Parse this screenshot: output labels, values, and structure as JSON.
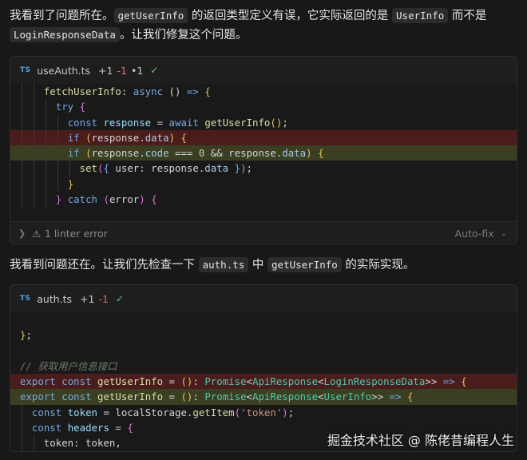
{
  "para1": {
    "t1": "我看到了问题所在。",
    "c1": "getUserInfo",
    "t2": " 的返回类型定义有误，它实际返回的是 ",
    "c2": "UserInfo",
    "t3": " 而不是",
    "c3": "LoginResponseData",
    "t4": "。让我们修复这个问题。"
  },
  "card1": {
    "lang": "TS",
    "filename": "useAuth.ts",
    "stat_add": "+1",
    "stat_del": "-1",
    "stat_mod": "•1",
    "footer_label": "1 linter error",
    "footer_action": "Auto-fix"
  },
  "para2": {
    "t1": "我看到问题还在。让我们先检查一下 ",
    "c1": "auth.ts",
    "t2": " 中 ",
    "c2": "getUserInfo",
    "t3": " 的实际实现。"
  },
  "card2": {
    "lang": "TS",
    "filename": "auth.ts",
    "stat_add": "+1",
    "stat_del": "-1"
  },
  "code1": [
    {
      "type": "normal",
      "indent": 2,
      "tokens": [
        [
          "fn",
          "fetchUserInfo"
        ],
        [
          "txt",
          ": "
        ],
        [
          "kw",
          "async"
        ],
        [
          "txt",
          " () "
        ],
        [
          "kw",
          "=>"
        ],
        [
          "txt",
          " "
        ],
        [
          "br1",
          "{"
        ]
      ]
    },
    {
      "type": "normal",
      "indent": 3,
      "tokens": [
        [
          "kw",
          "try"
        ],
        [
          "txt",
          " "
        ],
        [
          "br2",
          "{"
        ]
      ]
    },
    {
      "type": "normal",
      "indent": 4,
      "tokens": [
        [
          "kw",
          "const"
        ],
        [
          "txt",
          " "
        ],
        [
          "var",
          "response"
        ],
        [
          "txt",
          " = "
        ],
        [
          "kw",
          "await"
        ],
        [
          "txt",
          " "
        ],
        [
          "fn",
          "getUserInfo"
        ],
        [
          "br1",
          "()"
        ],
        [
          "txt",
          ";"
        ]
      ]
    },
    {
      "type": "del",
      "indent": 4,
      "tokens": [
        [
          "kw",
          "if"
        ],
        [
          "txt",
          " "
        ],
        [
          "br1",
          "("
        ],
        [
          "txt",
          "response."
        ],
        [
          "prop",
          "data"
        ],
        [
          "br1",
          ")"
        ],
        [
          "txt",
          " "
        ],
        [
          "br1",
          "{"
        ]
      ]
    },
    {
      "type": "add",
      "indent": 4,
      "tokens": [
        [
          "kw",
          "if"
        ],
        [
          "txt",
          " "
        ],
        [
          "br1",
          "("
        ],
        [
          "txt",
          "response."
        ],
        [
          "prop",
          "code"
        ],
        [
          "txt",
          " === "
        ],
        [
          "num",
          "0"
        ],
        [
          "txt",
          " && response."
        ],
        [
          "prop",
          "data"
        ],
        [
          "br1",
          ")"
        ],
        [
          "txt",
          " "
        ],
        [
          "br1",
          "{"
        ]
      ]
    },
    {
      "type": "normal",
      "indent": 5,
      "tokens": [
        [
          "fn",
          "set"
        ],
        [
          "br2",
          "("
        ],
        [
          "br3",
          "{"
        ],
        [
          "txt",
          " user: response."
        ],
        [
          "prop",
          "data"
        ],
        [
          "txt",
          " "
        ],
        [
          "br3",
          "}"
        ],
        [
          "br2",
          ")"
        ],
        [
          "txt",
          ";"
        ]
      ]
    },
    {
      "type": "normal",
      "indent": 4,
      "tokens": [
        [
          "br1",
          "}"
        ]
      ]
    },
    {
      "type": "normal",
      "indent": 3,
      "tokens": [
        [
          "br2",
          "}"
        ],
        [
          "txt",
          " "
        ],
        [
          "kw",
          "catch"
        ],
        [
          "txt",
          " "
        ],
        [
          "br2",
          "("
        ],
        [
          "txt",
          "error"
        ],
        [
          "br2",
          ")"
        ],
        [
          "txt",
          " "
        ],
        [
          "br2",
          "{"
        ]
      ]
    }
  ],
  "code2": [
    {
      "type": "normal",
      "indent": 0,
      "tokens": [
        [
          "txt",
          ""
        ]
      ]
    },
    {
      "type": "normal",
      "indent": 0,
      "tokens": [
        [
          "br1",
          "}"
        ],
        [
          "txt",
          ";"
        ]
      ]
    },
    {
      "type": "normal",
      "indent": 0,
      "tokens": [
        [
          "txt",
          ""
        ]
      ]
    },
    {
      "type": "normal",
      "indent": 0,
      "tokens": [
        [
          "cm",
          "// 获取用户信息接口"
        ]
      ]
    },
    {
      "type": "del",
      "indent": 0,
      "tokens": [
        [
          "kw",
          "export"
        ],
        [
          "txt",
          " "
        ],
        [
          "kw",
          "const"
        ],
        [
          "txt",
          " "
        ],
        [
          "fn",
          "getUserInfo"
        ],
        [
          "txt",
          " = "
        ],
        [
          "br1",
          "()"
        ],
        [
          "txt",
          ": "
        ],
        [
          "type",
          "Promise"
        ],
        [
          "txt",
          "<"
        ],
        [
          "type",
          "ApiResponse"
        ],
        [
          "txt",
          "<"
        ],
        [
          "type",
          "LoginResponseData"
        ],
        [
          "txt",
          ">> "
        ],
        [
          "kw",
          "=>"
        ],
        [
          "txt",
          " "
        ],
        [
          "br1",
          "{"
        ]
      ]
    },
    {
      "type": "add",
      "indent": 0,
      "tokens": [
        [
          "kw",
          "export"
        ],
        [
          "txt",
          " "
        ],
        [
          "kw",
          "const"
        ],
        [
          "txt",
          " "
        ],
        [
          "fn",
          "getUserInfo"
        ],
        [
          "txt",
          " = "
        ],
        [
          "br1",
          "()"
        ],
        [
          "txt",
          ": "
        ],
        [
          "type",
          "Promise"
        ],
        [
          "txt",
          "<"
        ],
        [
          "type",
          "ApiResponse"
        ],
        [
          "txt",
          "<"
        ],
        [
          "type",
          "UserInfo"
        ],
        [
          "txt",
          ">> "
        ],
        [
          "kw",
          "=>"
        ],
        [
          "txt",
          " "
        ],
        [
          "br1",
          "{"
        ]
      ]
    },
    {
      "type": "normal",
      "indent": 1,
      "tokens": [
        [
          "kw",
          "const"
        ],
        [
          "txt",
          " "
        ],
        [
          "var",
          "token"
        ],
        [
          "txt",
          " = localStorage."
        ],
        [
          "fn",
          "getItem"
        ],
        [
          "br2",
          "("
        ],
        [
          "str",
          "'token'"
        ],
        [
          "br2",
          ")"
        ],
        [
          "txt",
          ";"
        ]
      ]
    },
    {
      "type": "normal",
      "indent": 1,
      "tokens": [
        [
          "kw",
          "const"
        ],
        [
          "txt",
          " "
        ],
        [
          "var",
          "headers"
        ],
        [
          "txt",
          " = "
        ],
        [
          "br2",
          "{"
        ]
      ]
    },
    {
      "type": "normal",
      "indent": 2,
      "tokens": [
        [
          "txt",
          "token: token,"
        ]
      ]
    }
  ],
  "watermark": "掘金技术社区 @ 陈佬昔编程人生",
  "colors": {
    "del_bg": "#4a1c1c",
    "add_bg": "#3a3f22",
    "keyword": "#77a8e0",
    "function": "#dcdcaa"
  },
  "icons": {
    "lang": "ts-file-icon",
    "check": "check-icon",
    "warning": "warning-triangle-icon",
    "expand": "chevron-right-icon",
    "dropdown": "chevron-down-icon"
  }
}
